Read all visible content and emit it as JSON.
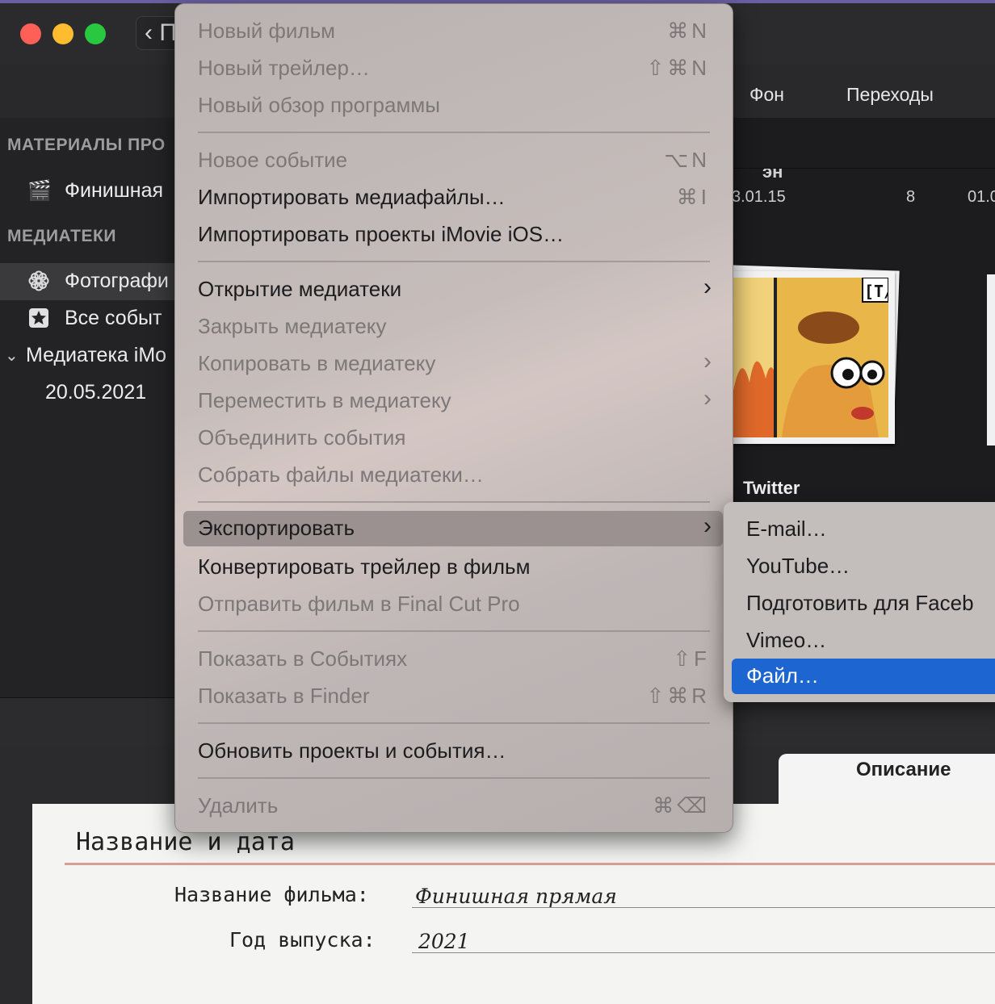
{
  "window": {
    "back_label": "‹ П",
    "toolbar_tabs": [
      "Фон",
      "Переходы"
    ]
  },
  "sidebar": {
    "section_project": "МАТЕРИАЛЫ ПРО",
    "project_item": "Финишная",
    "section_libraries": "МЕДИАТЕКИ",
    "items": [
      {
        "icon": "photos-flower-icon",
        "label": "Фотографи"
      },
      {
        "icon": "star-icon",
        "label": "Все событ"
      }
    ],
    "library_label": "Медиатека iMo",
    "library_date": "20.05.2021"
  },
  "content": {
    "col_header": "эн",
    "date_col": "3.01.15",
    "count_col": "8",
    "date_col2": "01.0",
    "thumb_text": "[T/",
    "event_title": "Twitter"
  },
  "menu": {
    "items": [
      {
        "label": "Новый фильм",
        "shortcut": "⌘N",
        "enabled": false
      },
      {
        "label": "Новый трейлер…",
        "shortcut": "⇧⌘N",
        "enabled": false
      },
      {
        "label": "Новый обзор программы",
        "shortcut": "",
        "enabled": false
      },
      {
        "label": "Новое событие",
        "shortcut": "⌥N",
        "enabled": false
      },
      {
        "label": "Импортировать медиафайлы…",
        "shortcut": "⌘I",
        "enabled": true
      },
      {
        "label": "Импортировать проекты iMovie iOS…",
        "shortcut": "",
        "enabled": true
      },
      {
        "label": "Открытие медиатеки",
        "submenu": true,
        "enabled": true
      },
      {
        "label": "Закрыть медиатеку",
        "enabled": false
      },
      {
        "label": "Копировать в медиатеку",
        "submenu": true,
        "enabled": false
      },
      {
        "label": "Переместить в медиатеку",
        "submenu": true,
        "enabled": false
      },
      {
        "label": "Объединить события",
        "enabled": false
      },
      {
        "label": "Собрать файлы медиатеки…",
        "enabled": false
      },
      {
        "label": "Экспортировать",
        "submenu": true,
        "enabled": true,
        "highlighted": true
      },
      {
        "label": "Конвертировать трейлер в фильм",
        "enabled": true
      },
      {
        "label": "Отправить фильм в Final Cut Pro",
        "enabled": false
      },
      {
        "label": "Показать в Событиях",
        "shortcut": "⇧F",
        "enabled": false
      },
      {
        "label": "Показать в Finder",
        "shortcut": "⇧⌘R",
        "enabled": false
      },
      {
        "label": "Обновить проекты и события…",
        "enabled": true
      },
      {
        "label": "Удалить",
        "shortcut": "⌘⌫",
        "enabled": false
      }
    ]
  },
  "export_submenu": {
    "items": [
      {
        "label": "E-mail…"
      },
      {
        "label": "YouTube…"
      },
      {
        "label": "Подготовить для Faceb"
      },
      {
        "label": "Vimeo…"
      },
      {
        "label": "Файл…",
        "highlighted": true
      }
    ]
  },
  "description_panel": {
    "tab_label": "Описание",
    "section_title": "Название и дата",
    "film_name_label": "Название фильма:",
    "film_name_value": "Финишная прямая",
    "year_label": "Год выпуска:",
    "year_value": "2021"
  },
  "colors": {
    "highlight_blue": "#1d66d1",
    "menu_bg": "#c3bdbc",
    "rule_accent": "#d4a095"
  }
}
